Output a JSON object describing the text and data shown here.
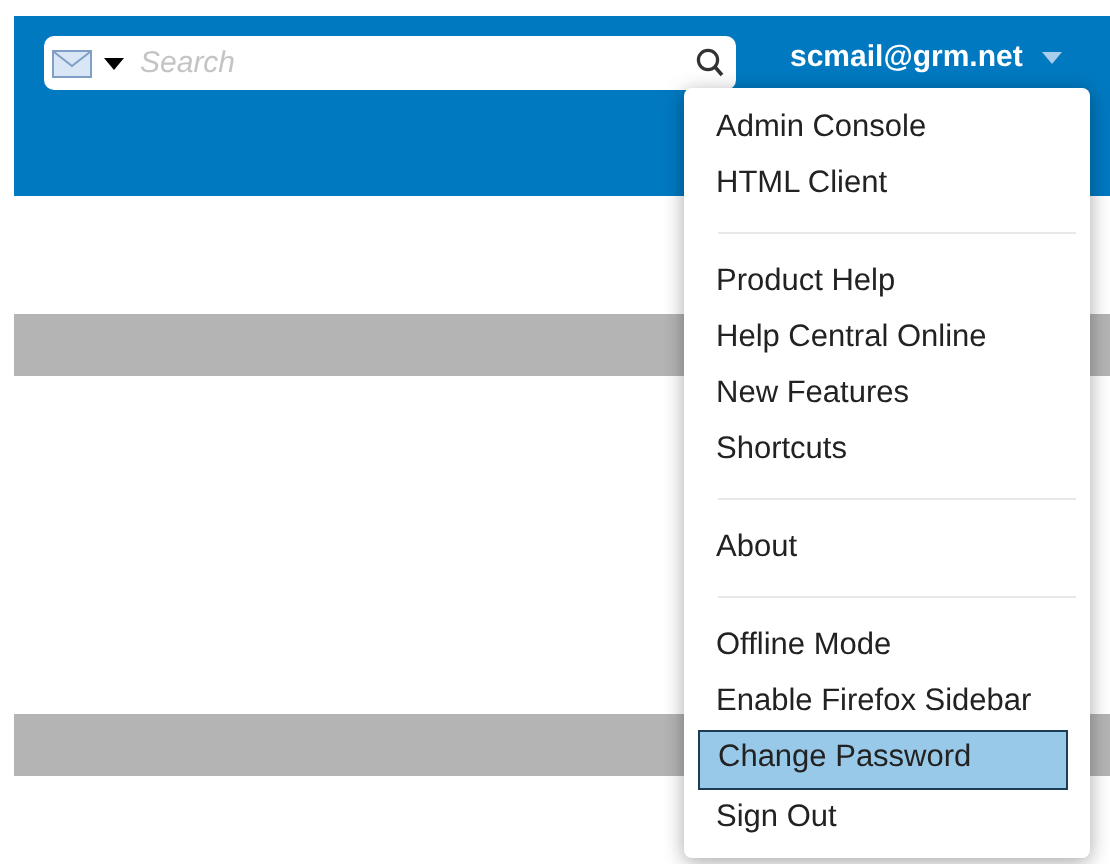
{
  "search": {
    "placeholder": "Search"
  },
  "user": {
    "name": "scmail@grm.net"
  },
  "menu": {
    "groups": [
      [
        {
          "label": "Admin Console",
          "selected": false
        },
        {
          "label": "HTML Client",
          "selected": false
        }
      ],
      [
        {
          "label": "Product Help",
          "selected": false
        },
        {
          "label": "Help Central Online",
          "selected": false
        },
        {
          "label": "New Features",
          "selected": false
        },
        {
          "label": "Shortcuts",
          "selected": false
        }
      ],
      [
        {
          "label": "About",
          "selected": false
        }
      ],
      [
        {
          "label": "Offline Mode",
          "selected": false
        },
        {
          "label": "Enable Firefox Sidebar",
          "selected": false
        },
        {
          "label": "Change Password",
          "selected": true
        },
        {
          "label": "Sign Out",
          "selected": false
        }
      ]
    ]
  }
}
